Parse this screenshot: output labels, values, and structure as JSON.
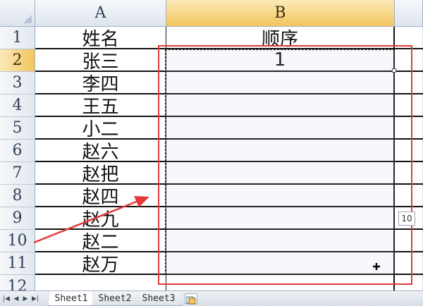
{
  "columns": [
    {
      "label": "A"
    },
    {
      "label": "B"
    }
  ],
  "rows": [
    {
      "num": "1",
      "a": "姓名",
      "b": "顺序"
    },
    {
      "num": "2",
      "a": "张三",
      "b": "1"
    },
    {
      "num": "3",
      "a": "李四",
      "b": ""
    },
    {
      "num": "4",
      "a": "王五",
      "b": ""
    },
    {
      "num": "5",
      "a": "小二",
      "b": ""
    },
    {
      "num": "6",
      "a": "赵六",
      "b": ""
    },
    {
      "num": "7",
      "a": "赵把",
      "b": ""
    },
    {
      "num": "8",
      "a": "赵四",
      "b": ""
    },
    {
      "num": "9",
      "a": "赵九",
      "b": ""
    },
    {
      "num": "10",
      "a": "赵二",
      "b": ""
    },
    {
      "num": "11",
      "a": "赵万",
      "b": ""
    },
    {
      "num": "12",
      "a": "",
      "b": ""
    }
  ],
  "autofill_tip": "10",
  "sheets": [
    {
      "label": "Sheet1",
      "active": true
    },
    {
      "label": "Sheet2",
      "active": false
    },
    {
      "label": "Sheet3",
      "active": false
    }
  ],
  "colors": {
    "annotation": "#e23a3a",
    "active_header": "#f3c55c",
    "header": "#dfe5ee"
  },
  "icons": {
    "nav_first": "first-sheet-icon",
    "nav_prev": "prev-sheet-icon",
    "nav_next": "next-sheet-icon",
    "nav_last": "last-sheet-icon",
    "new_sheet": "insert-sheet-icon",
    "cursor": "fill-crosshair-icon"
  }
}
